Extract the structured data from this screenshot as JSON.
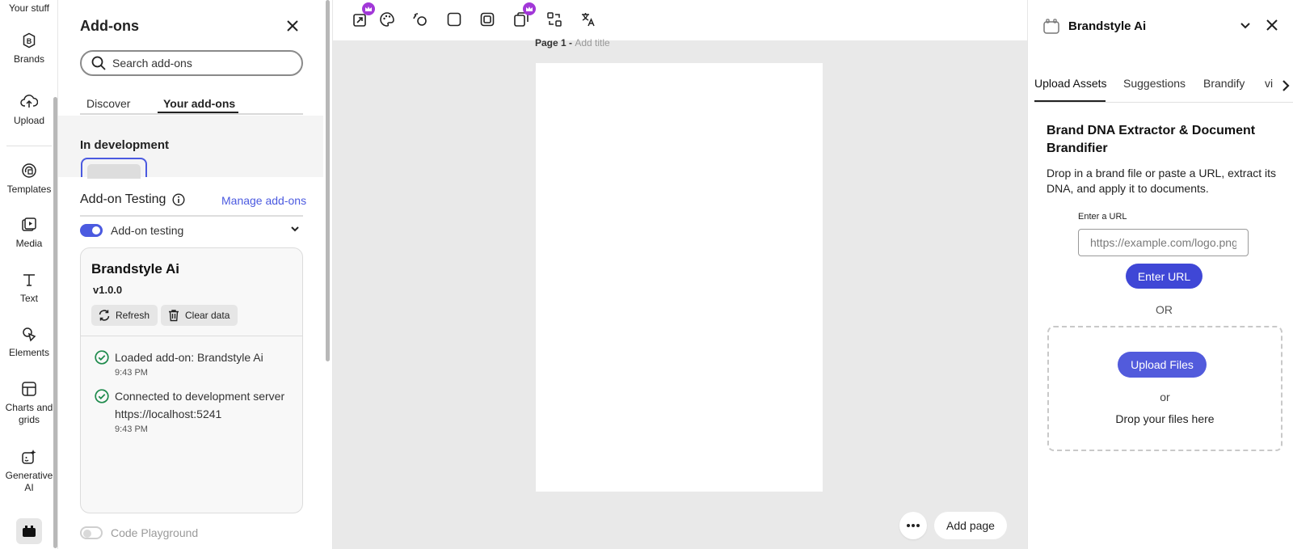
{
  "rail": {
    "top_label": "Your stuff",
    "items": [
      {
        "label": "Brands",
        "icon": "brands-icon"
      },
      {
        "label": "Upload",
        "icon": "upload-icon"
      },
      {
        "label": "Templates",
        "icon": "templates-icon"
      },
      {
        "label": "Media",
        "icon": "media-icon"
      },
      {
        "label": "Text",
        "icon": "text-icon"
      },
      {
        "label": "Elements",
        "icon": "elements-icon"
      },
      {
        "label": "Charts and grids",
        "icon": "charts-icon"
      },
      {
        "label": "Generative AI",
        "icon": "generative-ai-icon"
      }
    ]
  },
  "addons": {
    "title": "Add-ons",
    "search_placeholder": "Search add-ons",
    "tabs": [
      "Discover",
      "Your add-ons"
    ],
    "active_tab": "Your add-ons",
    "in_development": "In development",
    "testing_title": "Add-on Testing",
    "manage_link": "Manage add-ons",
    "toggle_label": "Add-on testing",
    "card": {
      "name": "Brandstyle Ai",
      "version": "v1.0.0",
      "refresh": "Refresh",
      "clear": "Clear data",
      "logs": [
        {
          "text": "Loaded add-on: Brandstyle Ai",
          "time": "9:43 PM"
        },
        {
          "text": "Connected to development server",
          "text2": "https://localhost:5241",
          "time": "9:43 PM"
        }
      ]
    },
    "code_playground": "Code Playground"
  },
  "canvas": {
    "page_label": "Page 1 -",
    "page_title_placeholder": "Add title",
    "add_page": "Add page"
  },
  "right_panel": {
    "title": "Brandstyle Ai",
    "tabs": [
      "Upload Assets",
      "Suggestions",
      "Brandify",
      "vi"
    ],
    "heading": "Brand DNA Extractor & Document Brandifier",
    "description": "Drop in a brand file or paste a URL, extract its DNA, and apply it to documents.",
    "url_label": "Enter a URL",
    "url_placeholder": "https://example.com/logo.png",
    "enter_url": "Enter URL",
    "or": "OR",
    "upload_files": "Upload Files",
    "or_small": "or",
    "drop_text": "Drop your files here"
  },
  "colors": {
    "accent": "#4b5ae0",
    "premium": "#a238d8",
    "success": "#1e8a4c"
  }
}
